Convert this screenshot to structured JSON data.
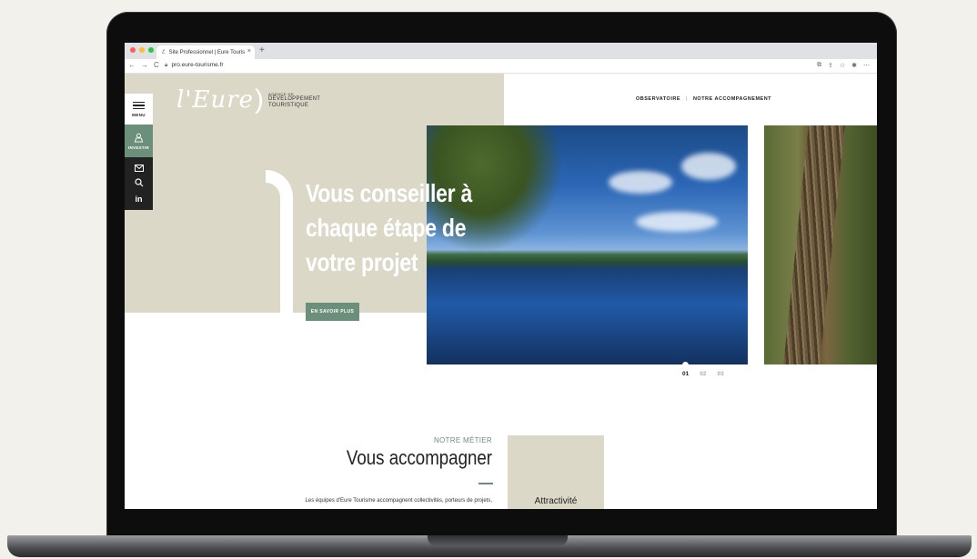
{
  "browser": {
    "tab_title": "Site Professionnel | Eure Touris",
    "tab_close": "×",
    "new_tab": "+",
    "url": "pro.eure-tourisme.fr",
    "nav": [
      "←",
      "→",
      "C"
    ]
  },
  "logo": {
    "script": "l'Eure",
    "paren": ")",
    "small": "AGENCE DE",
    "line1": "DÉVELOPPEMENT",
    "line2": "TOURISTIQUE"
  },
  "sidebar": {
    "menu_label": "MENU",
    "invest_label": "INVESTIR",
    "icons": [
      "mail-icon",
      "search-icon",
      "linkedin-icon"
    ],
    "linkedin_text": "in"
  },
  "topnav": {
    "items": [
      "OBSERVATOIRE",
      "NOTRE ACCOMPAGNEMENT"
    ],
    "separator": "|"
  },
  "hero": {
    "title_line1": "Vous conseiller à",
    "title_line2": "chaque étape de",
    "title_line3": "votre projet",
    "cta": "EN SAVOIR PLUS",
    "pages": [
      "01",
      "02",
      "03"
    ],
    "active_page": "01"
  },
  "section": {
    "kicker": "NOTRE MÉTIER",
    "title": "Vous accompagner",
    "text": "Les équipes d'Eure Tourisme accompagnent collectivités, porteurs de projets,",
    "card_label": "Attractivité"
  },
  "colors": {
    "accent_green": "#6b8f7b",
    "beige": "#dbd8c8",
    "dark": "#222222"
  }
}
